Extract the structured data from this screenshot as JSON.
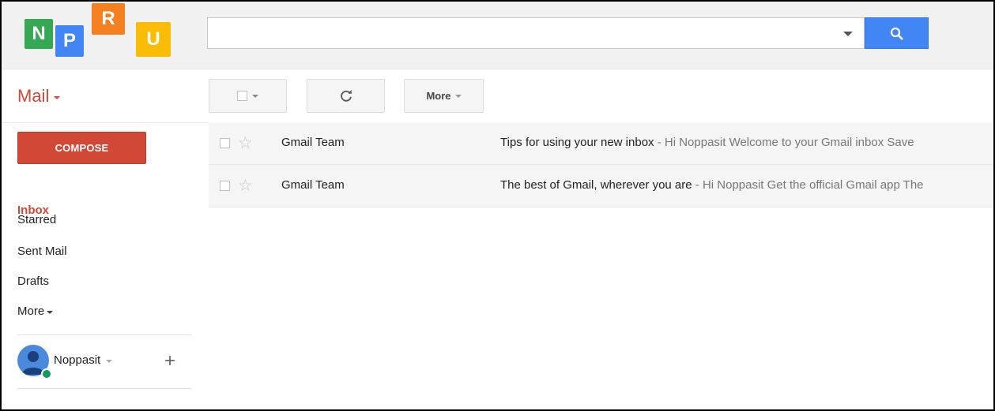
{
  "brand": {
    "logo_letters": [
      {
        "letter": "N",
        "color": "#34a853"
      },
      {
        "letter": "P",
        "color": "#4285f4"
      },
      {
        "letter": "R",
        "color": "#f4801f"
      },
      {
        "letter": "U",
        "color": "#fbbc05"
      }
    ]
  },
  "search": {
    "value": "",
    "placeholder": ""
  },
  "app_switcher": {
    "label": "Mail"
  },
  "toolbar": {
    "more_label": "More"
  },
  "sidebar": {
    "compose_label": "COMPOSE",
    "items": [
      {
        "label": "Inbox",
        "active": true
      },
      {
        "label": "Starred"
      },
      {
        "label": "Sent Mail"
      },
      {
        "label": "Drafts"
      },
      {
        "label": "More"
      }
    ],
    "account": {
      "name": "Noppasit",
      "status": "online"
    }
  },
  "emails": [
    {
      "sender": "Gmail Team",
      "subject": "Tips for using your new inbox",
      "snippet": " - Hi Noppasit Welcome to your Gmail inbox Save",
      "starred": false
    },
    {
      "sender": "Gmail Team",
      "subject": "The best of Gmail, wherever you are",
      "snippet": " - Hi Noppasit Get the official Gmail app The",
      "starred": false
    }
  ],
  "colors": {
    "accent_red": "#d14836",
    "search_blue": "#4285f4",
    "online_green": "#0f9d58"
  }
}
